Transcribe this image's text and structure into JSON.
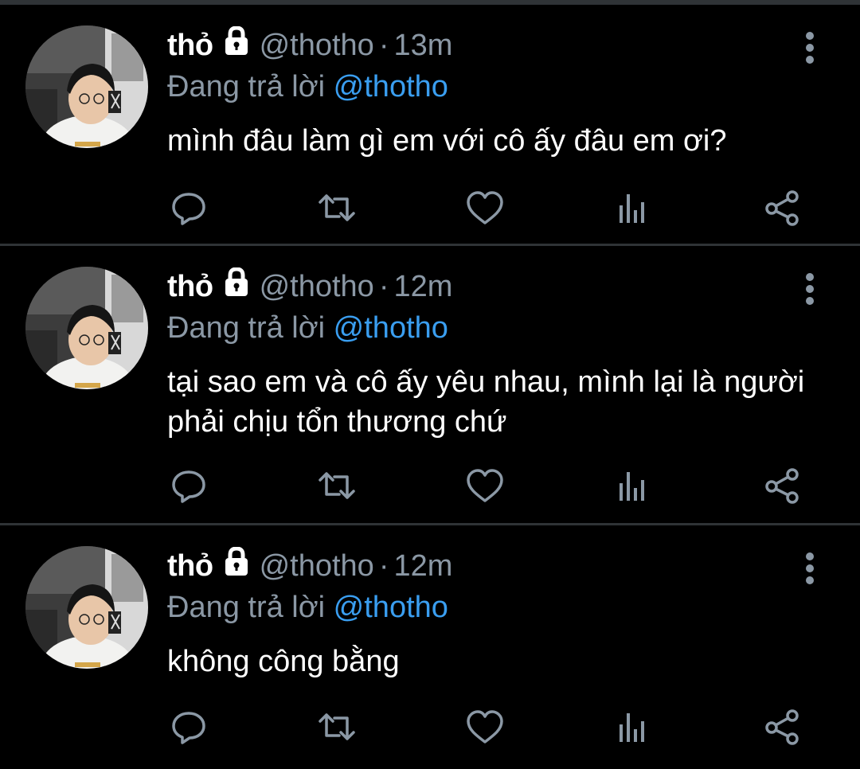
{
  "colors": {
    "background": "#000000",
    "divider": "#2f3336",
    "name": "#ffffff",
    "secondary": "#8b98a5",
    "mention": "#3a9ef0",
    "icon": "#8b98a5"
  },
  "tweets": [
    {
      "name": "thỏ",
      "handle": "@thotho",
      "separator": "·",
      "time": "13m",
      "reply_prefix": "Đang trả lời",
      "reply_to": "@thotho",
      "text": "mình đâu làm gì em với cô ấy đâu em ơi?",
      "actions": [
        "reply-icon",
        "retweet-icon",
        "like-icon",
        "analytics-icon",
        "share-icon"
      ]
    },
    {
      "name": "thỏ",
      "handle": "@thotho",
      "separator": "·",
      "time": "12m",
      "reply_prefix": "Đang trả lời",
      "reply_to": "@thotho",
      "text": "tại sao em và cô ấy yêu nhau, mình lại là người phải chịu tổn thương chứ",
      "actions": [
        "reply-icon",
        "retweet-icon",
        "like-icon",
        "analytics-icon",
        "share-icon"
      ]
    },
    {
      "name": "thỏ",
      "handle": "@thotho",
      "separator": "·",
      "time": "12m",
      "reply_prefix": "Đang trả lời",
      "reply_to": "@thotho",
      "text": "không công bằng",
      "actions": [
        "reply-icon",
        "retweet-icon",
        "like-icon",
        "analytics-icon",
        "share-icon"
      ]
    }
  ]
}
